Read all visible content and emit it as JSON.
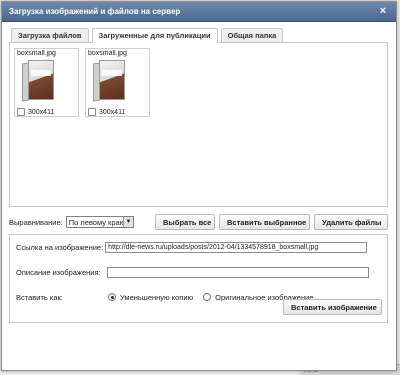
{
  "background": {
    "bottom_bar_text": "Ни 5P"
  },
  "dialog": {
    "title": "Загрузка изображений и файлов на сервер",
    "close_symbol": "×"
  },
  "tabs": [
    {
      "label": "Загрузка файлов"
    },
    {
      "label": "Загруженные для публикации"
    },
    {
      "label": "Общая папка"
    }
  ],
  "files": [
    {
      "name": "boxsmall.jpg",
      "size": "300x411"
    },
    {
      "name": "boxsmall.jpg",
      "size": "300x411"
    }
  ],
  "actions": {
    "align_label": "Выравнивание:",
    "align_value": "По левому краю",
    "select_all": "Выбрать все",
    "insert_selected": "Вставить выбранное",
    "delete_files": "Удалить файлы"
  },
  "form": {
    "url_label": "Ссылка на изображение:",
    "url_value": "http://dle-news.ru/uploads/posts/2012-04/1334578918_boxsmall.jpg",
    "desc_label": "Описание изображения:",
    "desc_value": "",
    "insert_as_label": "Вставить как:",
    "option_thumb": "Уменьшенную копию",
    "option_original": "Оригинальное изображение",
    "insert_button": "Вставить изображение"
  },
  "colors": {
    "titlebar": "#5a769c",
    "border": "#c7c7c7"
  }
}
